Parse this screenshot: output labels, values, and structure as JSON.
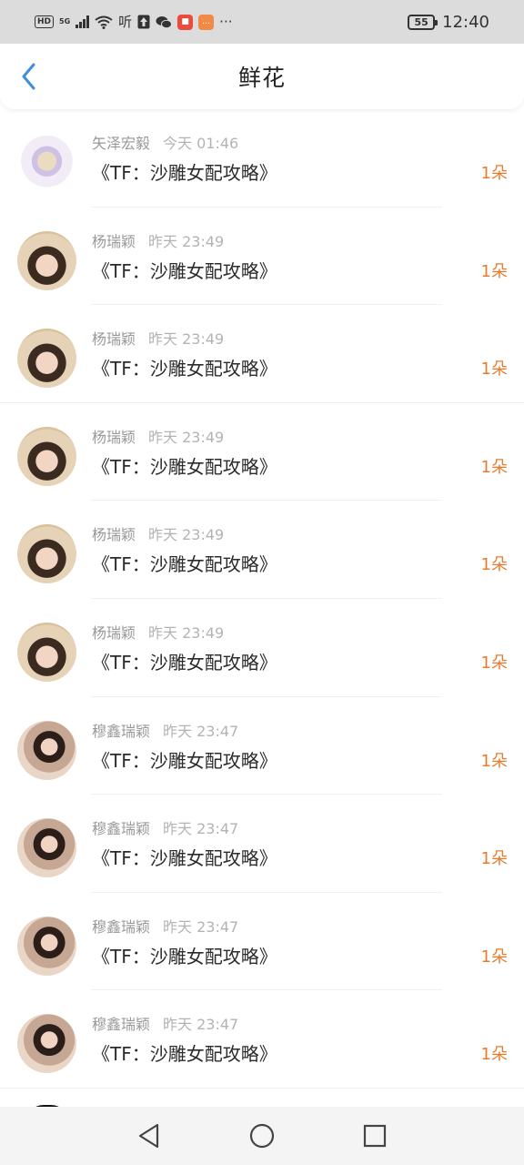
{
  "status_bar": {
    "hd_badge": "HD",
    "network": "5G",
    "speaker_glyph": "听",
    "battery": "55",
    "time": "12:40",
    "more": "···",
    "icons": [
      "wifi-icon",
      "upload-icon",
      "wechat-icon",
      "app-notification-icon",
      "message-icon"
    ]
  },
  "header": {
    "title": "鲜花",
    "back_icon": "chevron-left-icon"
  },
  "colors": {
    "accent_orange": "#e87c2e",
    "back_blue": "#3f8fdc",
    "muted_gray": "#999999",
    "text_dark": "#2b2b2b"
  },
  "rows": [
    {
      "name": "矢泽宏毅",
      "time": "今天 01:46",
      "book": "《TF：沙雕女配攻略》",
      "count": "1朵"
    },
    {
      "name": "杨瑞颖",
      "time": "昨天 23:49",
      "book": "《TF：沙雕女配攻略》",
      "count": "1朵"
    },
    {
      "name": "杨瑞颖",
      "time": "昨天 23:49",
      "book": "《TF：沙雕女配攻略》",
      "count": "1朵"
    },
    {
      "name": "杨瑞颖",
      "time": "昨天 23:49",
      "book": "《TF：沙雕女配攻略》",
      "count": "1朵"
    },
    {
      "name": "杨瑞颖",
      "time": "昨天 23:49",
      "book": "《TF：沙雕女配攻略》",
      "count": "1朵"
    },
    {
      "name": "杨瑞颖",
      "time": "昨天 23:49",
      "book": "《TF：沙雕女配攻略》",
      "count": "1朵"
    },
    {
      "name": "穆鑫瑞颖",
      "time": "昨天 23:47",
      "book": "《TF：沙雕女配攻略》",
      "count": "1朵"
    },
    {
      "name": "穆鑫瑞颖",
      "time": "昨天 23:47",
      "book": "《TF：沙雕女配攻略》",
      "count": "1朵"
    },
    {
      "name": "穆鑫瑞颖",
      "time": "昨天 23:47",
      "book": "《TF：沙雕女配攻略》",
      "count": "1朵"
    },
    {
      "name": "穆鑫瑞颖",
      "time": "昨天 23:47",
      "book": "《TF：沙雕女配攻略》",
      "count": "1朵"
    }
  ],
  "nav_bar": {
    "icons": [
      "back-triangle-icon",
      "home-circle-icon",
      "recents-square-icon"
    ]
  }
}
